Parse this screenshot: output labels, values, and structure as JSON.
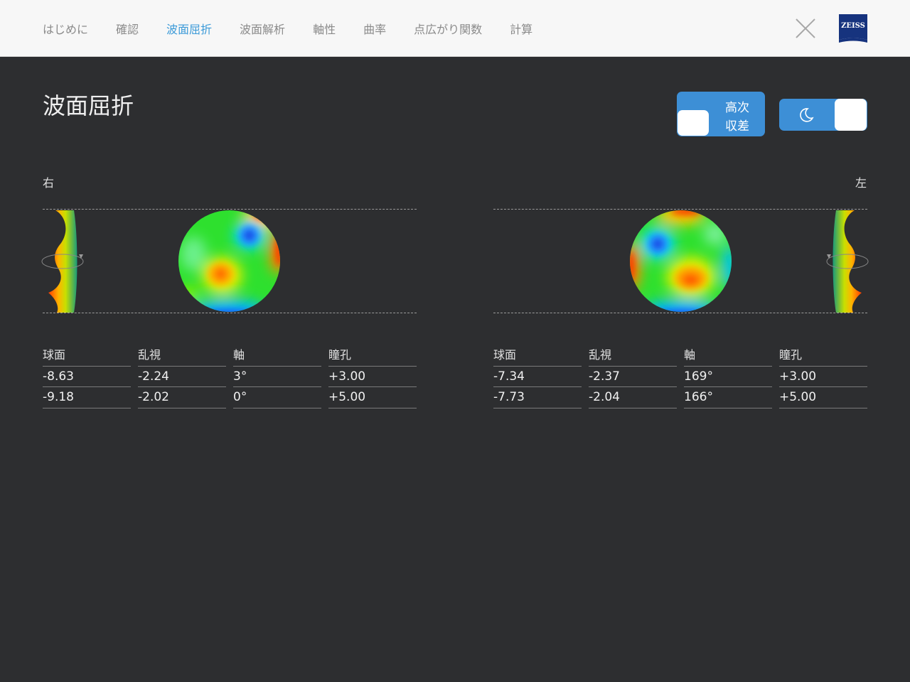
{
  "nav": {
    "tabs": [
      {
        "label": "はじめに",
        "active": false
      },
      {
        "label": "確認",
        "active": false
      },
      {
        "label": "波面屈折",
        "active": true
      },
      {
        "label": "波面解析",
        "active": false
      },
      {
        "label": "軸性",
        "active": false
      },
      {
        "label": "曲率",
        "active": false
      },
      {
        "label": "点広がり関数",
        "active": false
      },
      {
        "label": "計算",
        "active": false
      }
    ],
    "close_icon": "close-icon",
    "logo_text": "ZEISS"
  },
  "page": {
    "title": "波面屈折"
  },
  "toggles": {
    "higher_order": {
      "label_line1": "高次",
      "label_line2": "収差",
      "on": false
    },
    "night_mode": {
      "icon": "moon-icon",
      "on": true
    }
  },
  "eyes": {
    "right": {
      "label": "右",
      "headers": [
        "球面",
        "乱視",
        "軸",
        "瞳孔"
      ],
      "rows": [
        [
          "-8.63",
          "-2.24",
          "3°",
          "+3.00"
        ],
        [
          "-9.18",
          "-2.02",
          "0°",
          "+5.00"
        ]
      ]
    },
    "left": {
      "label": "左",
      "headers": [
        "球面",
        "乱視",
        "軸",
        "瞳孔"
      ],
      "rows": [
        [
          "-7.34",
          "-2.37",
          "169°",
          "+3.00"
        ],
        [
          "-7.73",
          "-2.04",
          "166°",
          "+5.00"
        ]
      ]
    }
  },
  "colors": {
    "accent": "#3b9ad8",
    "toggle_bg": "#3d8fd6",
    "background": "#2d2e30",
    "topbar": "#f7f7f7"
  }
}
